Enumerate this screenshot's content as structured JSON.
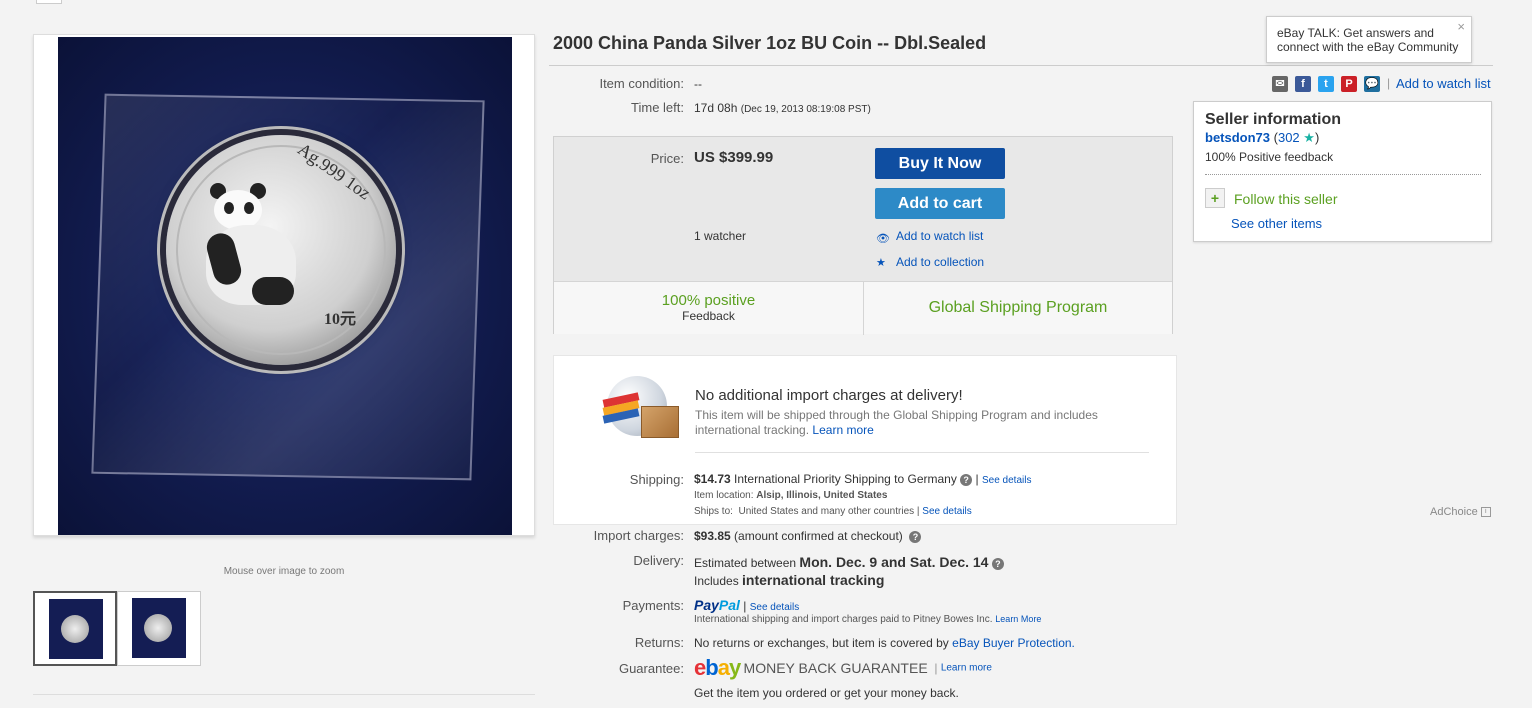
{
  "item": {
    "title": "2000 China Panda Silver 1oz BU Coin -- Dbl.Sealed",
    "zoom_hint": "Mouse over image to zoom",
    "coin_text_top": "Ag.999 1oz",
    "coin_text_value": "10元"
  },
  "details": {
    "condition_label": "Item condition:",
    "condition_value": "--",
    "time_left_label": "Time left:",
    "time_left_value": "17d 08h",
    "time_left_end": "(Dec 19, 2013   08:19:08 PST)"
  },
  "buybox": {
    "price_label": "Price:",
    "price_value": "US $399.99",
    "buy_now_label": "Buy It Now",
    "add_to_cart_label": "Add to cart",
    "watchers": "1 watcher",
    "add_watch_label": "Add to watch list",
    "add_collection_label": "Add to collection",
    "positive_big": "100% positive",
    "positive_small": "Feedback",
    "gsp_label": "Global Shipping Program"
  },
  "shipping_box": {
    "headline": "No additional import charges at delivery!",
    "desc": "This item will be shipped through the Global Shipping Program and includes international tracking.",
    "learn_more": "Learn more",
    "shipping_label": "Shipping:",
    "shipping_price": "$14.73",
    "shipping_method": "International Priority Shipping to Germany",
    "see_details": "See details",
    "item_location_label": "Item location:",
    "item_location": "Alsip, Illinois, United States",
    "ships_to_label": "Ships to:",
    "ships_to": "United States and many other countries",
    "ships_to_details": "See details"
  },
  "charges": {
    "import_label": "Import charges:",
    "import_value": "$93.85",
    "import_note": "(amount confirmed at checkout)",
    "delivery_label": "Delivery:",
    "delivery_prefix": "Estimated between",
    "delivery_dates": "Mon. Dec. 9 and Sat. Dec. 14",
    "tracking_prefix": "Includes",
    "tracking_value": "international tracking",
    "payments_label": "Payments:",
    "paypal_p1": "Pay",
    "paypal_p2": "Pal",
    "payments_see": "See details",
    "payments_note": "International shipping and import charges paid to Pitney Bowes Inc.",
    "payments_learn": "Learn More",
    "returns_label": "Returns:",
    "returns_text": "No returns or exchanges, but item is covered by",
    "returns_link": "eBay Buyer Protection.",
    "guarantee_label": "Guarantee:",
    "ebay_e": "e",
    "ebay_b": "b",
    "ebay_a": "a",
    "ebay_y": "y",
    "mbg": "MONEY BACK GUARANTEE",
    "guarantee_learn": "Learn more",
    "guarantee_note": "Get the item you ordered or get your money back."
  },
  "right": {
    "talk_text": "eBay TALK: Get answers and connect with the eBay Community",
    "talk_close": "×",
    "add_watch_top": "Add to watch list",
    "seller_heading": "Seller information",
    "seller_name": "betsdon73",
    "seller_count": "302",
    "seller_feedback": "100% Positive feedback",
    "follow_label": "Follow this seller",
    "other_items_label": "See other items",
    "adchoice": "AdChoice"
  },
  "icons": {
    "facebook": "f",
    "twitter": "t",
    "pinterest": "P",
    "plus": "+"
  },
  "colors": {
    "buy_now": "#0f4ea1",
    "add_to_cart": "#2d8ac7",
    "link": "#0654ba",
    "positive_green": "#5ba021"
  }
}
